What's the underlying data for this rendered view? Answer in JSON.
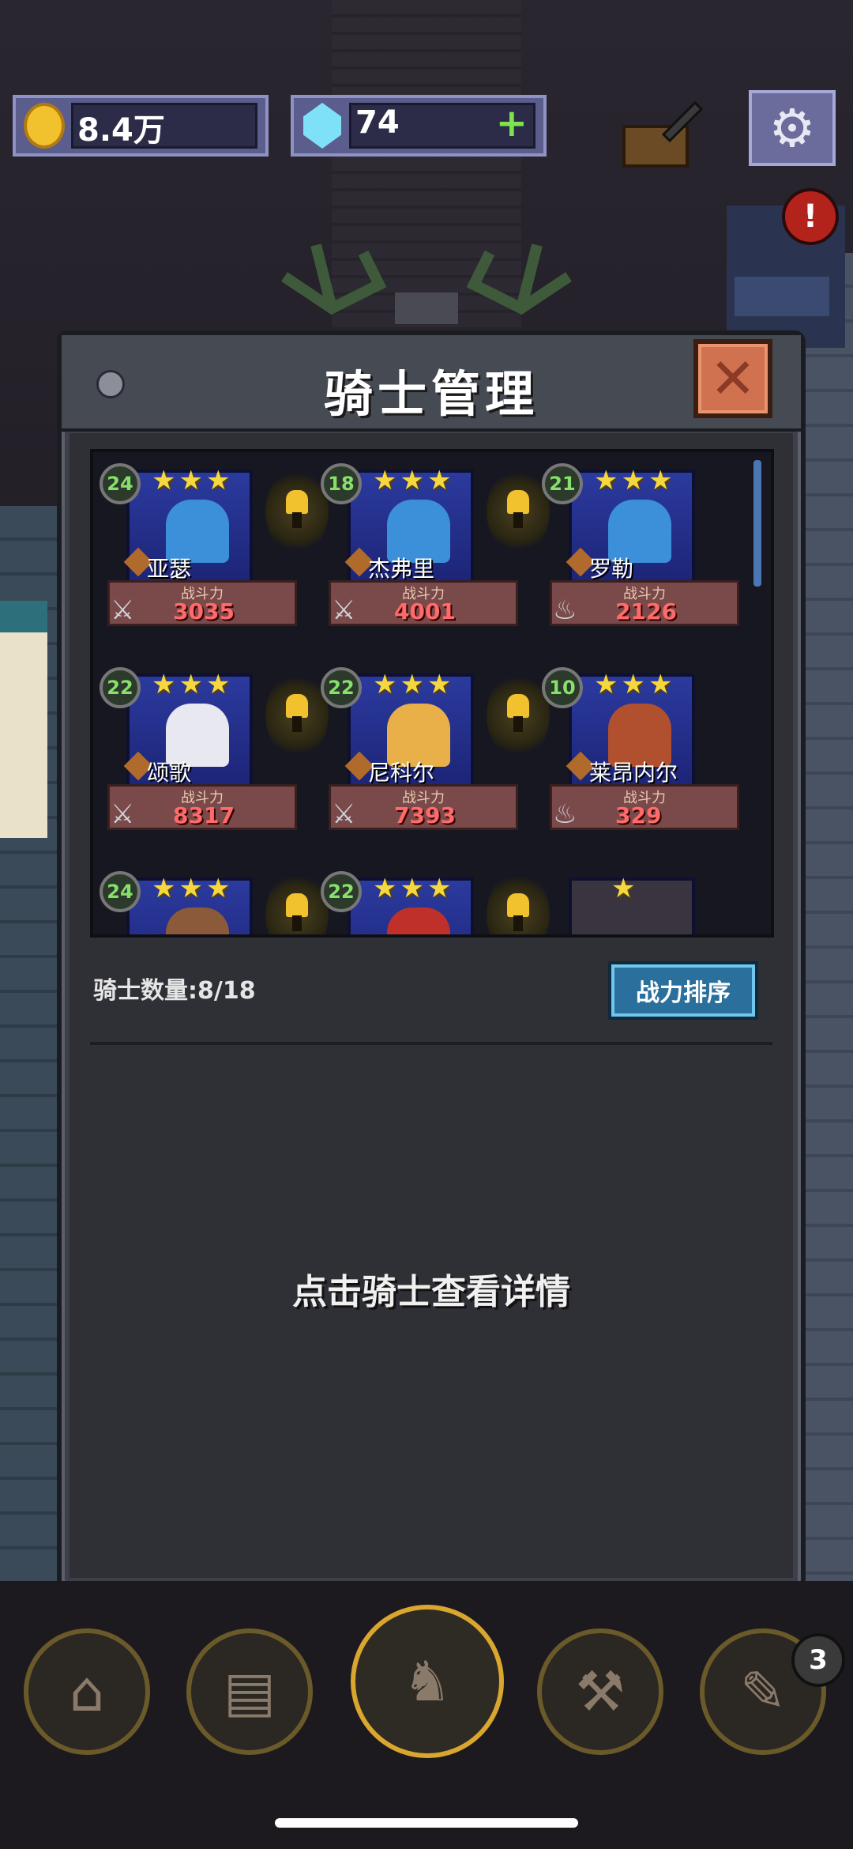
{
  "resources": {
    "gold": "8.4万",
    "gems": "74",
    "add_symbol": "+"
  },
  "shop_alert": "!",
  "panel": {
    "title": "骑士管理",
    "close_symbol": "✕",
    "knight_count_label": "骑士数量:8/18",
    "sort_button": "战力排序",
    "hint": "点击骑士查看详情",
    "power_label": "战斗力"
  },
  "knights": [
    {
      "level": "24",
      "stars": "★★★",
      "name": "亚瑟",
      "power": "3035",
      "color": "#3c8fd9"
    },
    {
      "level": "18",
      "stars": "★★★",
      "name": "杰弗里",
      "power": "4001",
      "color": "#3c8fd9"
    },
    {
      "level": "21",
      "stars": "★★★",
      "name": "罗勒",
      "power": "2126",
      "color": "#3c8fd9"
    },
    {
      "level": "22",
      "stars": "★★★",
      "name": "颂歌",
      "power": "8317",
      "color": "#e8e8f0"
    },
    {
      "level": "22",
      "stars": "★★★",
      "name": "尼科尔",
      "power": "7393",
      "color": "#e9b04a"
    },
    {
      "level": "10",
      "stars": "★★★",
      "name": "莱昂内尔",
      "power": "329",
      "color": "#b0502e"
    },
    {
      "level": "24",
      "stars": "★★★",
      "name": "",
      "power": "",
      "color": "#8a5a3a"
    },
    {
      "level": "22",
      "stars": "★★★",
      "name": "",
      "power": "",
      "color": "#c0302a"
    },
    {
      "level": "",
      "stars": "★",
      "name": "",
      "power": "",
      "color": "#3a3440"
    }
  ],
  "nav": {
    "badge": "3"
  }
}
